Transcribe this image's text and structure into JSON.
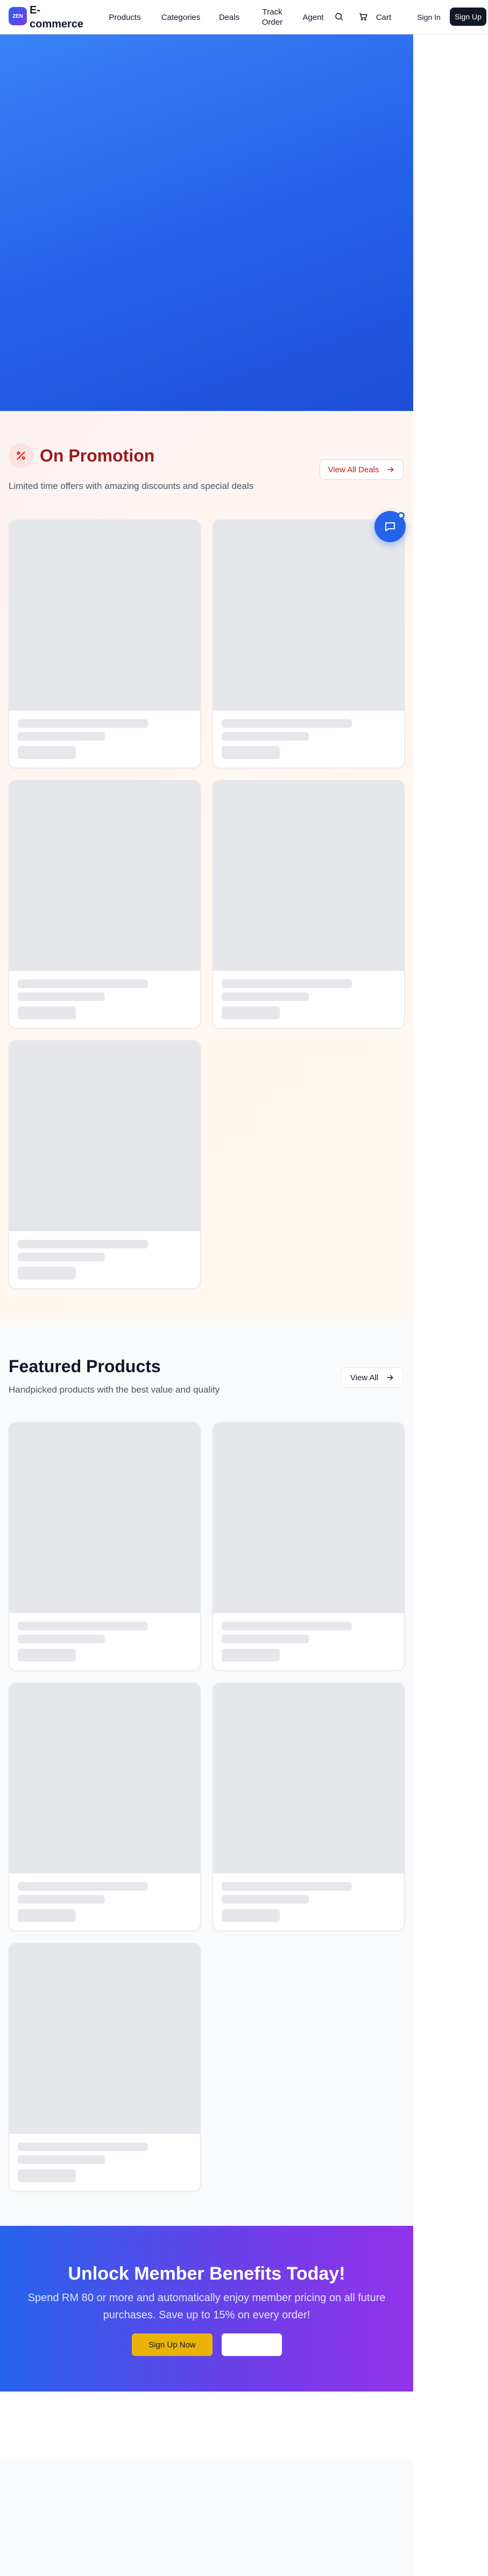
{
  "header": {
    "logo_text": "2EN",
    "brand": "E-commerce",
    "nav": [
      "Products",
      "Categories",
      "Deals",
      "Track Order",
      "Agent"
    ],
    "cart_label": "Cart",
    "signin_label": "Sign In",
    "signup_label": "Sign Up",
    "icons": [
      "search-icon",
      "cart-icon"
    ]
  },
  "promotion": {
    "title": "On Promotion",
    "subtitle": "Limited time offers with amazing discounts and special deals",
    "view_all_label": "View All Deals",
    "icon": "percent-icon",
    "accent": "#991b1b",
    "card_count": 5,
    "cards_loading": true
  },
  "featured": {
    "title": "Featured Products",
    "subtitle": "Handpicked products with the best value and quality",
    "view_all_label": "View All",
    "card_count": 5,
    "cards_loading": true
  },
  "cta": {
    "title": "Unlock Member Benefits Today!",
    "subtitle": "Spend RM 80 or more and automatically enjoy member pricing on all future purchases. Save up to 15% on every order!",
    "primary_label": "Sign Up Now",
    "secondary_label": "",
    "primary_color": "#eab308"
  },
  "chat": {
    "icon": "chat-bubble-icon"
  },
  "colors": {
    "hero": "#2563eb",
    "brand_dark": "#111827",
    "skeleton": "#e5e7eb"
  }
}
